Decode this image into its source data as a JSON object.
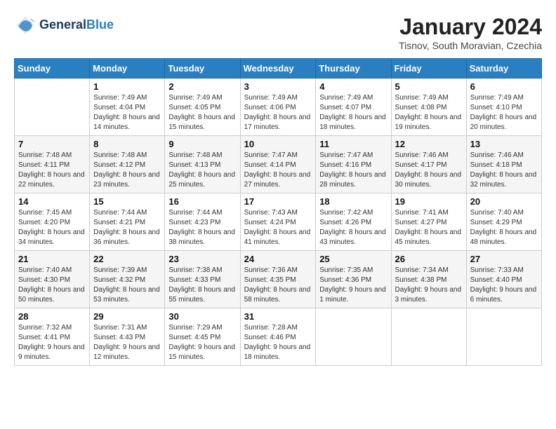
{
  "header": {
    "logo_line1": "General",
    "logo_line2": "Blue",
    "month": "January 2024",
    "location": "Tisnov, South Moravian, Czechia"
  },
  "weekdays": [
    "Sunday",
    "Monday",
    "Tuesday",
    "Wednesday",
    "Thursday",
    "Friday",
    "Saturday"
  ],
  "weeks": [
    [
      {
        "day": "",
        "sunrise": "",
        "sunset": "",
        "daylight": ""
      },
      {
        "day": "1",
        "sunrise": "Sunrise: 7:49 AM",
        "sunset": "Sunset: 4:04 PM",
        "daylight": "Daylight: 8 hours and 14 minutes."
      },
      {
        "day": "2",
        "sunrise": "Sunrise: 7:49 AM",
        "sunset": "Sunset: 4:05 PM",
        "daylight": "Daylight: 8 hours and 15 minutes."
      },
      {
        "day": "3",
        "sunrise": "Sunrise: 7:49 AM",
        "sunset": "Sunset: 4:06 PM",
        "daylight": "Daylight: 8 hours and 17 minutes."
      },
      {
        "day": "4",
        "sunrise": "Sunrise: 7:49 AM",
        "sunset": "Sunset: 4:07 PM",
        "daylight": "Daylight: 8 hours and 18 minutes."
      },
      {
        "day": "5",
        "sunrise": "Sunrise: 7:49 AM",
        "sunset": "Sunset: 4:08 PM",
        "daylight": "Daylight: 8 hours and 19 minutes."
      },
      {
        "day": "6",
        "sunrise": "Sunrise: 7:49 AM",
        "sunset": "Sunset: 4:10 PM",
        "daylight": "Daylight: 8 hours and 20 minutes."
      }
    ],
    [
      {
        "day": "7",
        "sunrise": "Sunrise: 7:48 AM",
        "sunset": "Sunset: 4:11 PM",
        "daylight": "Daylight: 8 hours and 22 minutes."
      },
      {
        "day": "8",
        "sunrise": "Sunrise: 7:48 AM",
        "sunset": "Sunset: 4:12 PM",
        "daylight": "Daylight: 8 hours and 23 minutes."
      },
      {
        "day": "9",
        "sunrise": "Sunrise: 7:48 AM",
        "sunset": "Sunset: 4:13 PM",
        "daylight": "Daylight: 8 hours and 25 minutes."
      },
      {
        "day": "10",
        "sunrise": "Sunrise: 7:47 AM",
        "sunset": "Sunset: 4:14 PM",
        "daylight": "Daylight: 8 hours and 27 minutes."
      },
      {
        "day": "11",
        "sunrise": "Sunrise: 7:47 AM",
        "sunset": "Sunset: 4:16 PM",
        "daylight": "Daylight: 8 hours and 28 minutes."
      },
      {
        "day": "12",
        "sunrise": "Sunrise: 7:46 AM",
        "sunset": "Sunset: 4:17 PM",
        "daylight": "Daylight: 8 hours and 30 minutes."
      },
      {
        "day": "13",
        "sunrise": "Sunrise: 7:46 AM",
        "sunset": "Sunset: 4:18 PM",
        "daylight": "Daylight: 8 hours and 32 minutes."
      }
    ],
    [
      {
        "day": "14",
        "sunrise": "Sunrise: 7:45 AM",
        "sunset": "Sunset: 4:20 PM",
        "daylight": "Daylight: 8 hours and 34 minutes."
      },
      {
        "day": "15",
        "sunrise": "Sunrise: 7:44 AM",
        "sunset": "Sunset: 4:21 PM",
        "daylight": "Daylight: 8 hours and 36 minutes."
      },
      {
        "day": "16",
        "sunrise": "Sunrise: 7:44 AM",
        "sunset": "Sunset: 4:23 PM",
        "daylight": "Daylight: 8 hours and 38 minutes."
      },
      {
        "day": "17",
        "sunrise": "Sunrise: 7:43 AM",
        "sunset": "Sunset: 4:24 PM",
        "daylight": "Daylight: 8 hours and 41 minutes."
      },
      {
        "day": "18",
        "sunrise": "Sunrise: 7:42 AM",
        "sunset": "Sunset: 4:26 PM",
        "daylight": "Daylight: 8 hours and 43 minutes."
      },
      {
        "day": "19",
        "sunrise": "Sunrise: 7:41 AM",
        "sunset": "Sunset: 4:27 PM",
        "daylight": "Daylight: 8 hours and 45 minutes."
      },
      {
        "day": "20",
        "sunrise": "Sunrise: 7:40 AM",
        "sunset": "Sunset: 4:29 PM",
        "daylight": "Daylight: 8 hours and 48 minutes."
      }
    ],
    [
      {
        "day": "21",
        "sunrise": "Sunrise: 7:40 AM",
        "sunset": "Sunset: 4:30 PM",
        "daylight": "Daylight: 8 hours and 50 minutes."
      },
      {
        "day": "22",
        "sunrise": "Sunrise: 7:39 AM",
        "sunset": "Sunset: 4:32 PM",
        "daylight": "Daylight: 8 hours and 53 minutes."
      },
      {
        "day": "23",
        "sunrise": "Sunrise: 7:38 AM",
        "sunset": "Sunset: 4:33 PM",
        "daylight": "Daylight: 8 hours and 55 minutes."
      },
      {
        "day": "24",
        "sunrise": "Sunrise: 7:36 AM",
        "sunset": "Sunset: 4:35 PM",
        "daylight": "Daylight: 8 hours and 58 minutes."
      },
      {
        "day": "25",
        "sunrise": "Sunrise: 7:35 AM",
        "sunset": "Sunset: 4:36 PM",
        "daylight": "Daylight: 9 hours and 1 minute."
      },
      {
        "day": "26",
        "sunrise": "Sunrise: 7:34 AM",
        "sunset": "Sunset: 4:38 PM",
        "daylight": "Daylight: 9 hours and 3 minutes."
      },
      {
        "day": "27",
        "sunrise": "Sunrise: 7:33 AM",
        "sunset": "Sunset: 4:40 PM",
        "daylight": "Daylight: 9 hours and 6 minutes."
      }
    ],
    [
      {
        "day": "28",
        "sunrise": "Sunrise: 7:32 AM",
        "sunset": "Sunset: 4:41 PM",
        "daylight": "Daylight: 9 hours and 9 minutes."
      },
      {
        "day": "29",
        "sunrise": "Sunrise: 7:31 AM",
        "sunset": "Sunset: 4:43 PM",
        "daylight": "Daylight: 9 hours and 12 minutes."
      },
      {
        "day": "30",
        "sunrise": "Sunrise: 7:29 AM",
        "sunset": "Sunset: 4:45 PM",
        "daylight": "Daylight: 9 hours and 15 minutes."
      },
      {
        "day": "31",
        "sunrise": "Sunrise: 7:28 AM",
        "sunset": "Sunset: 4:46 PM",
        "daylight": "Daylight: 9 hours and 18 minutes."
      },
      {
        "day": "",
        "sunrise": "",
        "sunset": "",
        "daylight": ""
      },
      {
        "day": "",
        "sunrise": "",
        "sunset": "",
        "daylight": ""
      },
      {
        "day": "",
        "sunrise": "",
        "sunset": "",
        "daylight": ""
      }
    ]
  ]
}
